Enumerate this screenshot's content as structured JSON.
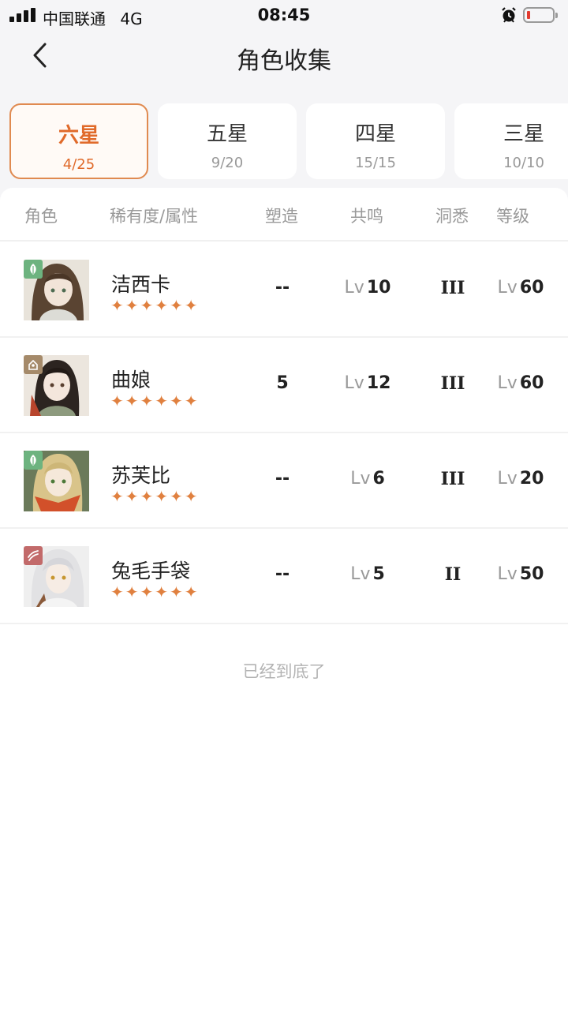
{
  "status": {
    "carrier": "中国联通",
    "network": "4G",
    "time": "08:45"
  },
  "nav": {
    "title": "角色收集",
    "back_icon": "chevron-left-icon"
  },
  "tabs": [
    {
      "label": "六星",
      "count": "4/25",
      "active": true
    },
    {
      "label": "五星",
      "count": "9/20",
      "active": false
    },
    {
      "label": "四星",
      "count": "15/15",
      "active": false
    },
    {
      "label": "三星",
      "count": "10/10",
      "active": false
    }
  ],
  "table": {
    "headers": [
      "角色",
      "稀有度/属性",
      "塑造",
      "共鸣",
      "洞悉",
      "等级"
    ],
    "lv_prefix": "Lv",
    "stars": "✦✦✦✦✦✦",
    "rows": [
      {
        "name": "洁西卡",
        "element": "leaf-icon",
        "element_color": "#6db37f",
        "mold": "--",
        "resonance": "10",
        "insight": "III",
        "level": "60"
      },
      {
        "name": "曲娘",
        "element": "hand-icon",
        "element_color": "#a58a6a",
        "mold": "5",
        "resonance": "12",
        "insight": "III",
        "level": "60"
      },
      {
        "name": "苏芙比",
        "element": "leaf-icon",
        "element_color": "#6db37f",
        "mold": "--",
        "resonance": "6",
        "insight": "III",
        "level": "20"
      },
      {
        "name": "兔毛手袋",
        "element": "claw-icon",
        "element_color": "#c26a6a",
        "mold": "--",
        "resonance": "5",
        "insight": "II",
        "level": "50"
      }
    ]
  },
  "footer": "已经到底了",
  "colors": {
    "accent": "#e06a2a",
    "star": "#e0803f",
    "muted": "#999999"
  }
}
